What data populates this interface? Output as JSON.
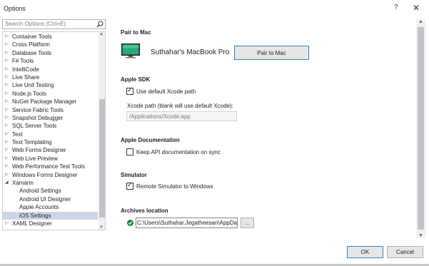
{
  "window": {
    "title": "Options",
    "help": "?",
    "close": "✕"
  },
  "search": {
    "placeholder": "Search Options (Ctrl+E)"
  },
  "tree": {
    "items": [
      {
        "label": "Container Tools",
        "arrow": "▷",
        "child": false,
        "selected": false
      },
      {
        "label": "Cross Platform",
        "arrow": "▷",
        "child": false,
        "selected": false
      },
      {
        "label": "Database Tools",
        "arrow": "▷",
        "child": false,
        "selected": false
      },
      {
        "label": "F# Tools",
        "arrow": "▷",
        "child": false,
        "selected": false
      },
      {
        "label": "IntelliCode",
        "arrow": "▷",
        "child": false,
        "selected": false
      },
      {
        "label": "Live Share",
        "arrow": "▷",
        "child": false,
        "selected": false
      },
      {
        "label": "Live Unit Testing",
        "arrow": "▷",
        "child": false,
        "selected": false
      },
      {
        "label": "Node.js Tools",
        "arrow": "▷",
        "child": false,
        "selected": false
      },
      {
        "label": "NuGet Package Manager",
        "arrow": "▷",
        "child": false,
        "selected": false
      },
      {
        "label": "Service Fabric Tools",
        "arrow": "▷",
        "child": false,
        "selected": false
      },
      {
        "label": "Snapshot Debugger",
        "arrow": "▷",
        "child": false,
        "selected": false
      },
      {
        "label": "SQL Server Tools",
        "arrow": "▷",
        "child": false,
        "selected": false
      },
      {
        "label": "Test",
        "arrow": "▷",
        "child": false,
        "selected": false
      },
      {
        "label": "Text Templating",
        "arrow": "▷",
        "child": false,
        "selected": false
      },
      {
        "label": "Web Forms Designer",
        "arrow": "▷",
        "child": false,
        "selected": false
      },
      {
        "label": "Web Live Preview",
        "arrow": "▷",
        "child": false,
        "selected": false
      },
      {
        "label": "Web Performance Test Tools",
        "arrow": "▷",
        "child": false,
        "selected": false
      },
      {
        "label": "Windows Forms Designer",
        "arrow": "▷",
        "child": false,
        "selected": false
      },
      {
        "label": "Xamarin",
        "arrow": "◢",
        "child": false,
        "selected": false
      },
      {
        "label": "Android Settings",
        "arrow": "",
        "child": true,
        "selected": false
      },
      {
        "label": "Android UI Designer",
        "arrow": "",
        "child": true,
        "selected": false
      },
      {
        "label": "Apple Accounts",
        "arrow": "",
        "child": true,
        "selected": false
      },
      {
        "label": "iOS Settings",
        "arrow": "",
        "child": true,
        "selected": true
      },
      {
        "label": "XAML Designer",
        "arrow": "▷",
        "child": false,
        "selected": false
      }
    ]
  },
  "pair": {
    "heading": "Pair to Mac",
    "mac_name": "Suthahar's MacBook Pro",
    "button": "Pair to Mac"
  },
  "sdk": {
    "heading": "Apple SDK",
    "use_default_label": "Use default Xcode path",
    "use_default_checked": true,
    "path_label": "Xcode path (blank will use default Xcode):",
    "path_value": "/Applications/Xcode.app"
  },
  "docs": {
    "heading": "Apple Documentation",
    "keep_label": "Keep API documentation on sync",
    "keep_checked": false
  },
  "simulator": {
    "heading": "Simulator",
    "remote_label": "Remote Simulator to Windows",
    "remote_checked": true
  },
  "archives": {
    "heading": "Archives location",
    "path": "C:\\Users\\Suthahar.Jegatheesan\\AppData\\",
    "browse": "..."
  },
  "footer": {
    "ok": "OK",
    "cancel": "Cancel"
  },
  "colors": {
    "accent": "#3c7fb1",
    "selected_row": "#cdd6e6",
    "ok_icon": "#1e8a3c"
  }
}
